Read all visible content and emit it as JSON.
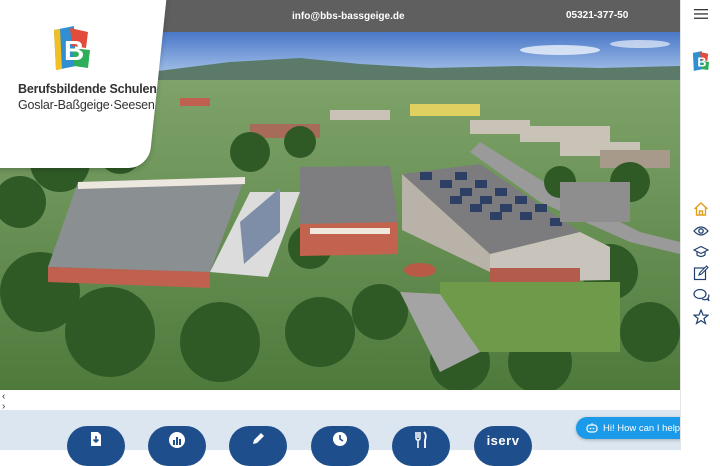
{
  "topbar": {
    "email": "info@bbs-bassgeige.de",
    "phone": "05321-377-50"
  },
  "logo": {
    "title": "Berufsbildende Schulen",
    "subtitle": "Goslar-Baßgeige·Seesen"
  },
  "slider": {
    "prev": "‹",
    "next": "›"
  },
  "quicklinks": [
    {
      "icon": "download-doc-icon"
    },
    {
      "icon": "chart-icon"
    },
    {
      "icon": "pencil-icon"
    },
    {
      "icon": "clock-icon"
    },
    {
      "icon": "cutlery-icon"
    },
    {
      "label": "iserv"
    }
  ],
  "sidebar": {
    "icons": [
      "menu-icon",
      "school-logo-icon",
      "home-icon",
      "eye-icon",
      "graduation-cap-icon",
      "edit-icon",
      "chat-icon",
      "star-icon"
    ]
  },
  "chat": {
    "label": "Hi! How can I help you?"
  },
  "colors": {
    "topbar": "#5f5f5f",
    "navy": "#1f4e8c",
    "accent": "#1a9ae8",
    "sidebar_icon": "#1f3f6e",
    "home_icon": "#e0a020"
  }
}
